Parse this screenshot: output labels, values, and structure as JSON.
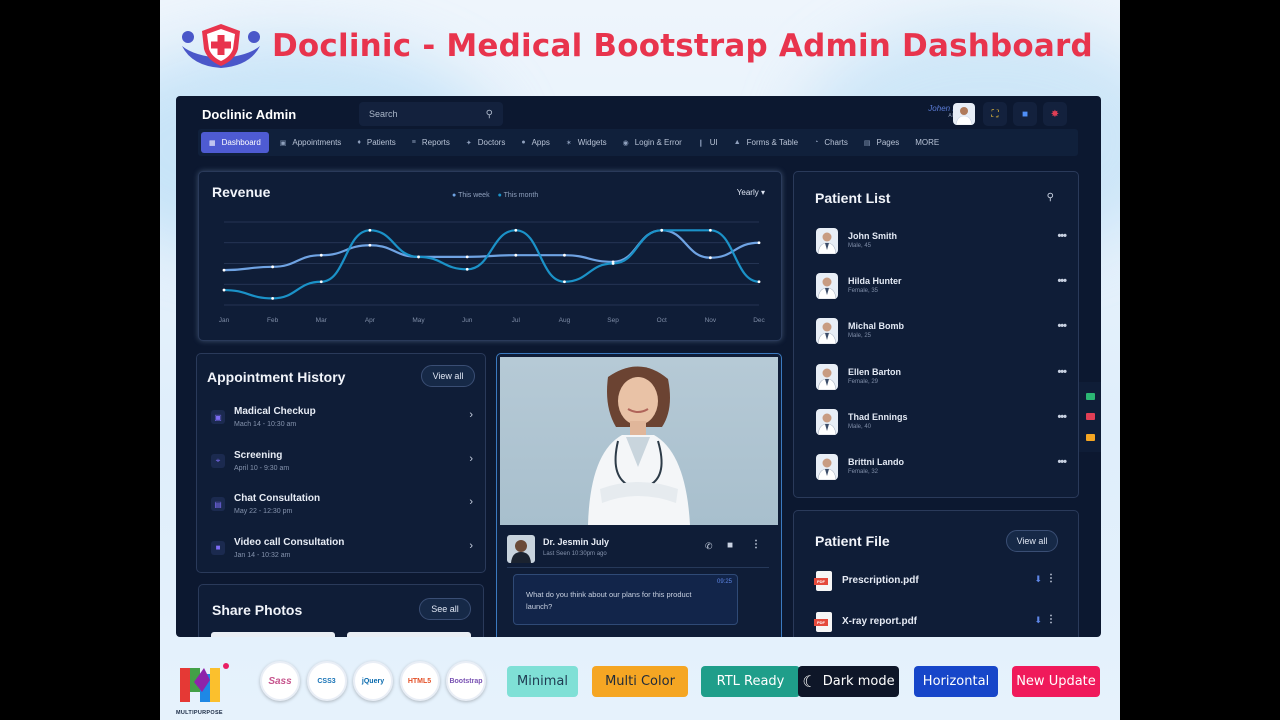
{
  "hero": {
    "title": "Doclinic - Medical Bootstrap Admin Dashboard"
  },
  "topbar": {
    "brand": "Doclinic Admin",
    "search_placeholder": "Search",
    "user_name": "Johen Doe",
    "user_role": "ADMIN"
  },
  "nav": [
    {
      "label": "Dashboard",
      "icon": "grid-icon",
      "active": true
    },
    {
      "label": "Appointments",
      "icon": "calendar-icon"
    },
    {
      "label": "Patients",
      "icon": "users-icon"
    },
    {
      "label": "Reports",
      "icon": "chart-icon"
    },
    {
      "label": "Doctors",
      "icon": "doctor-icon"
    },
    {
      "label": "Apps",
      "icon": "apps-icon"
    },
    {
      "label": "Widgets",
      "icon": "widget-icon"
    },
    {
      "label": "Login & Error",
      "icon": "login-icon"
    },
    {
      "label": "UI",
      "icon": "ui-icon"
    },
    {
      "label": "Forms & Table",
      "icon": "form-icon"
    },
    {
      "label": "Charts",
      "icon": "pie-icon"
    },
    {
      "label": "Pages",
      "icon": "page-icon"
    },
    {
      "label": "MORE",
      "icon": ""
    }
  ],
  "revenue": {
    "title": "Revenue",
    "filter": "Yearly",
    "legend": [
      "This week",
      "This month"
    ],
    "colors": {
      "this_week": "#6fa3e3",
      "this_month": "#1b92c8"
    }
  },
  "chart_data": {
    "type": "line",
    "categories": [
      "Jan",
      "Feb",
      "Mar",
      "Apr",
      "May",
      "Jun",
      "Jul",
      "Aug",
      "Sep",
      "Oct",
      "Nov",
      "Dec"
    ],
    "series": [
      {
        "name": "This week",
        "values": [
          42,
          46,
          60,
          72,
          58,
          58,
          60,
          60,
          52,
          90,
          57,
          75
        ]
      },
      {
        "name": "This month",
        "values": [
          18,
          8,
          28,
          90,
          58,
          43,
          90,
          28,
          50,
          90,
          90,
          28
        ]
      }
    ],
    "ylim": [
      0,
      100
    ],
    "grid": true
  },
  "appointments": {
    "title": "Appointment History",
    "view_all": "View all",
    "items": [
      {
        "title": "Madical Checkup",
        "sub": "Mach 14 - 10:30 am",
        "icon": "calendar-icon"
      },
      {
        "title": "Screening",
        "sub": "April 10 - 9:30 am",
        "icon": "scan-icon"
      },
      {
        "title": "Chat Consultation",
        "sub": "May 22 - 12:30 pm",
        "icon": "chat-icon"
      },
      {
        "title": "Video call Consultation",
        "sub": "Jan 14 - 10:32 am",
        "icon": "video-icon"
      }
    ]
  },
  "share": {
    "title": "Share Photos",
    "view_all": "See all"
  },
  "doctor_chat": {
    "name": "Dr. Jesmin July",
    "last_seen": "Last Seen 10:30pm ago",
    "message_time": "09:25",
    "message": "What do you think about our plans for this product launch?"
  },
  "patients": {
    "title": "Patient List",
    "items": [
      {
        "name": "John Smith",
        "info": "Male, 45"
      },
      {
        "name": "Hilda Hunter",
        "info": "Female, 35"
      },
      {
        "name": "Michal Bomb",
        "info": "Male, 25"
      },
      {
        "name": "Ellen Barton",
        "info": "Female, 29"
      },
      {
        "name": "Thad Ennings",
        "info": "Male, 40"
      },
      {
        "name": "Brittni Lando",
        "info": "Female, 32"
      }
    ]
  },
  "files": {
    "title": "Patient File",
    "view_all": "View all",
    "items": [
      {
        "name": "Prescription.pdf"
      },
      {
        "name": "X-ray report.pdf"
      }
    ]
  },
  "tech": [
    "Sass",
    "CSS3",
    "jQuery",
    "HTML5",
    "Bootstrap"
  ],
  "logo_caption": "MULTIPURPOSE",
  "badges": [
    {
      "label": "Minimal",
      "bg": "#7fe0d6",
      "fg": "#1f3b52"
    },
    {
      "label": "Multi Color",
      "bg": "#f5a623",
      "fg": "#1f2b3a"
    },
    {
      "label": "RTL Ready",
      "bg": "#1f9e8a",
      "fg": "#ffffff"
    },
    {
      "label": "Dark mode",
      "bg": "#0e1628",
      "fg": "#ffffff"
    },
    {
      "label": "Horizontal",
      "bg": "#1746c9",
      "fg": "#ffffff"
    },
    {
      "label": "New Update",
      "bg": "#f01a5b",
      "fg": "#ffffff"
    }
  ]
}
